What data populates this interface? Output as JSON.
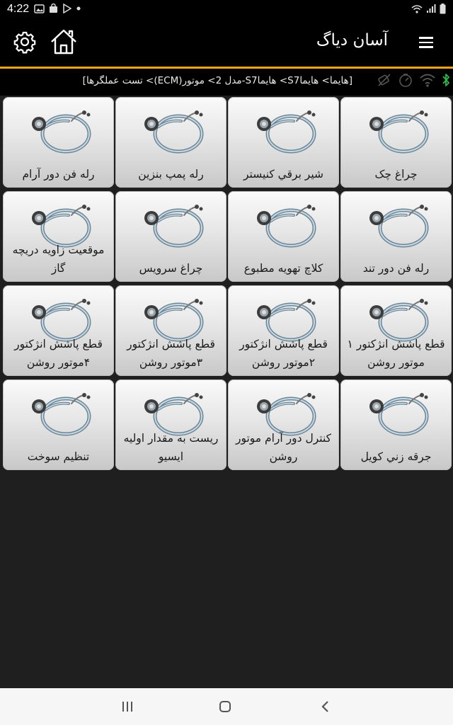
{
  "status_bar": {
    "time": "4:22",
    "left_icons": [
      "image-icon",
      "shopping-bag-icon",
      "play-store-icon",
      "dot-icon"
    ],
    "right_icons": [
      "wifi-icon",
      "signal-icon",
      "battery-icon"
    ]
  },
  "app_bar": {
    "title": "آسان دیاگ",
    "accent_color": "#f3a21b"
  },
  "breadcrumb": {
    "text": "[هايما> هايماS7> هايماS7-مدل 2> موتور(ECM)> تست عملگرها]"
  },
  "tiles": [
    {
      "label": "چراغ چک",
      "icon": "stethoscope-icon"
    },
    {
      "label": "شير برقي كنيستر",
      "icon": "stethoscope-icon"
    },
    {
      "label": "رله پمپ بنزين",
      "icon": "stethoscope-icon"
    },
    {
      "label": "رله فن دور آرام",
      "icon": "stethoscope-icon"
    },
    {
      "label": "رله فن دور تند",
      "icon": "stethoscope-icon"
    },
    {
      "label": "كلاچ تهويه مطبوع",
      "icon": "stethoscope-icon"
    },
    {
      "label": "چراغ سرويس",
      "icon": "stethoscope-icon"
    },
    {
      "label": "موقعيت زاويه دريچه گاز",
      "icon": "stethoscope-icon"
    },
    {
      "label": "قطع پاشش انژكتور ۱ موتور روشن",
      "icon": "stethoscope-icon"
    },
    {
      "label": "قطع پاشش انژكتور ۲موتور روشن",
      "icon": "stethoscope-icon"
    },
    {
      "label": "قطع پاشش انژكتور ۳موتور روشن",
      "icon": "stethoscope-icon"
    },
    {
      "label": "قطع پاشش انژكتور ۴موتور روشن",
      "icon": "stethoscope-icon"
    },
    {
      "label": "جرقه زني كويل",
      "icon": "stethoscope-icon"
    },
    {
      "label": "كنترل دور آرام موتور روشن",
      "icon": "stethoscope-icon"
    },
    {
      "label": "ريست به مقدار اوليه ايسيو",
      "icon": "stethoscope-icon"
    },
    {
      "label": "تنظيم سوخت",
      "icon": "stethoscope-icon"
    }
  ],
  "nav_bar": {
    "buttons": [
      "recent-apps-icon",
      "home-circle-icon",
      "back-icon"
    ]
  }
}
